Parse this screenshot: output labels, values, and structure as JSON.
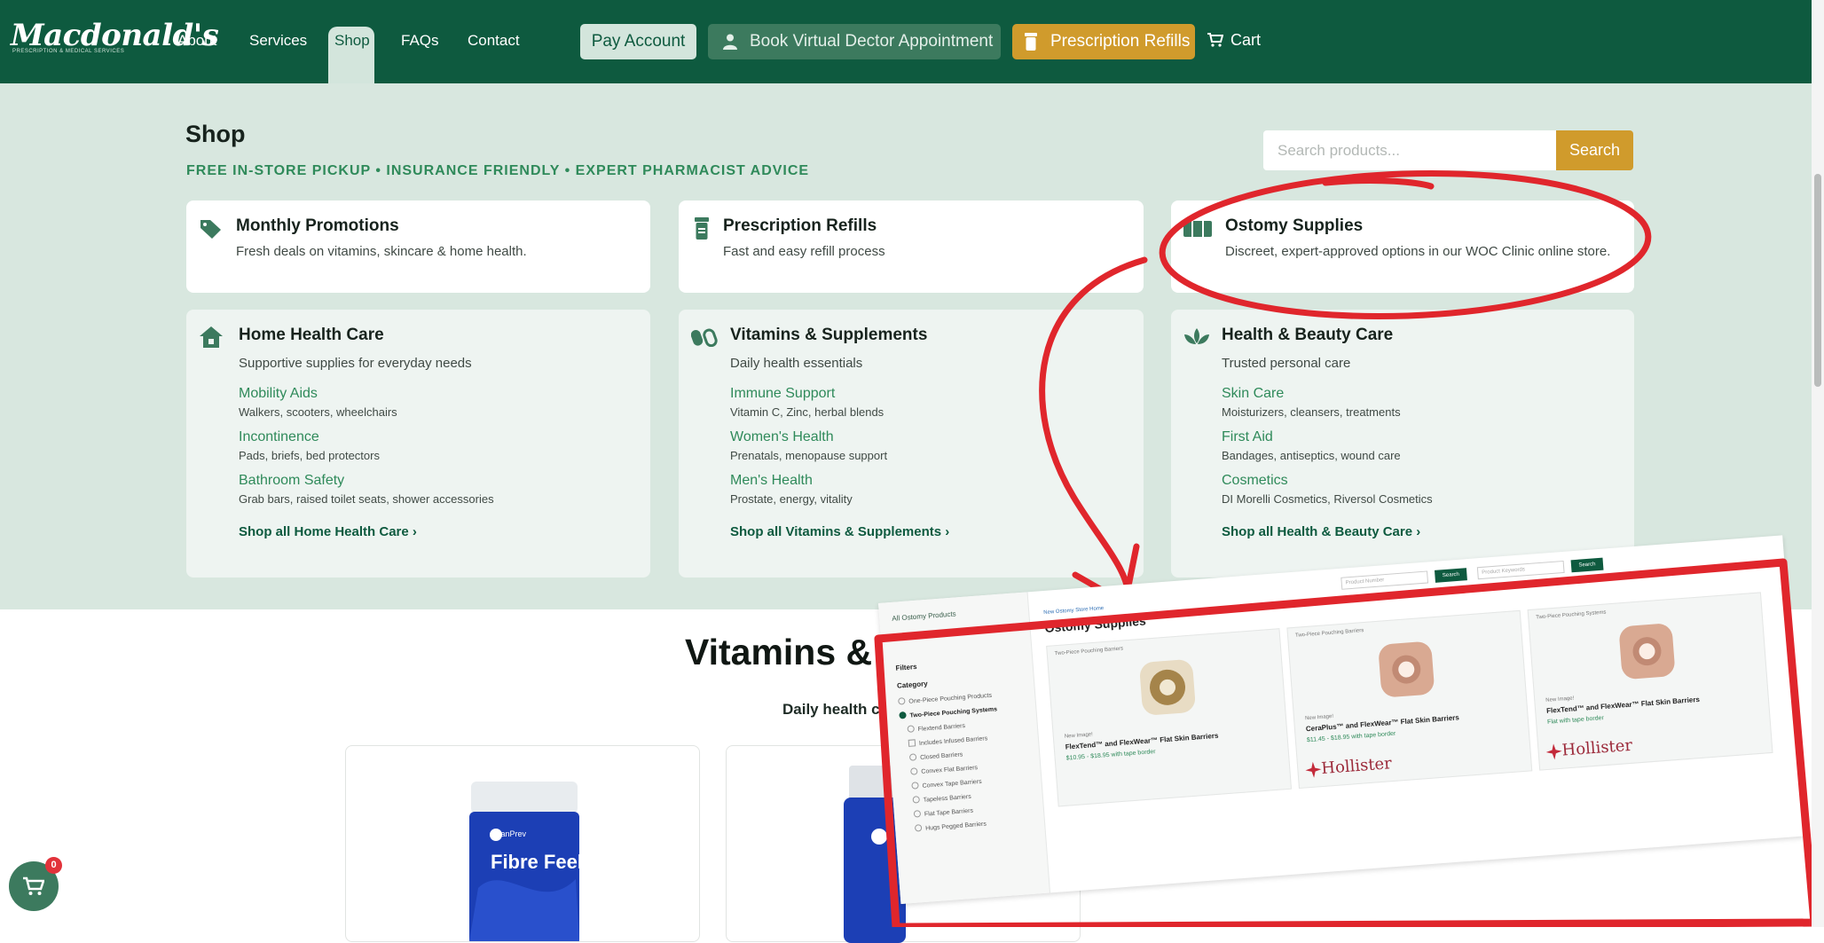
{
  "brand": {
    "name": "Macdonald's",
    "tagline": "PRESCRIPTION & MEDICAL SERVICES"
  },
  "nav": {
    "links": [
      "About",
      "Services",
      "Shop",
      "FAQs",
      "Contact"
    ],
    "active": "Shop",
    "pay_account": "Pay Account",
    "book_virtual": "Book Virtual Dector Appointment",
    "prescription_refills": "Prescription Refills",
    "cart": "Cart"
  },
  "shop": {
    "title": "Shop",
    "tagline": "FREE IN-STORE PICKUP • INSURANCE FRIENDLY • EXPERT PHARMACIST ADVICE",
    "search": {
      "placeholder": "Search products...",
      "button": "Search"
    },
    "top_cards": [
      {
        "title": "Monthly Promotions",
        "desc": "Fresh deals on vitamins, skincare & home health.",
        "icon": "tag-icon"
      },
      {
        "title": "Prescription Refills",
        "desc": "Fast and easy refill process",
        "icon": "pill-bottle-icon"
      },
      {
        "title": "Ostomy Supplies",
        "desc": "Discreet, expert-approved options in our WOC Clinic online store.",
        "icon": "supplies-icon"
      }
    ],
    "categories": [
      {
        "title": "Home Health Care",
        "desc": "Supportive supplies for everyday needs",
        "icon": "home-icon",
        "items": [
          {
            "label": "Mobility Aids",
            "desc": "Walkers, scooters, wheelchairs"
          },
          {
            "label": "Incontinence",
            "desc": "Pads, briefs, bed protectors"
          },
          {
            "label": "Bathroom Safety",
            "desc": "Grab bars, raised toilet seats, shower accessories"
          }
        ],
        "shop_all": "Shop all Home Health Care ›"
      },
      {
        "title": "Vitamins & Supplements",
        "desc": "Daily health essentials",
        "icon": "capsule-icon",
        "items": [
          {
            "label": "Immune Support",
            "desc": "Vitamin C, Zinc, herbal blends"
          },
          {
            "label": "Women's Health",
            "desc": "Prenatals, menopause support"
          },
          {
            "label": "Men's Health",
            "desc": "Prostate, energy, vitality"
          }
        ],
        "shop_all": "Shop all Vitamins & Supplements ›"
      },
      {
        "title": "Health & Beauty Care",
        "desc": "Trusted personal care",
        "icon": "lotus-icon",
        "items": [
          {
            "label": "Skin Care",
            "desc": "Moisturizers, cleansers, treatments"
          },
          {
            "label": "First Aid",
            "desc": "Bandages, antiseptics, wound care"
          },
          {
            "label": "Cosmetics",
            "desc": "DI Morelli Cosmetics, Riversol Cosmetics"
          }
        ],
        "shop_all": "Shop all Health & Beauty Care ›"
      }
    ]
  },
  "featured": {
    "title": "Vitamins & Supplements",
    "subtitle": "Daily health c",
    "products": [
      {
        "label": "Fibre Feel"
      },
      {
        "label": ""
      }
    ]
  },
  "cart_fab": {
    "count": "0"
  },
  "inset": {
    "back_link": "All Ostomy Products",
    "home_link": "Ostomy Shop Home",
    "filters": "Filters",
    "category": "Category",
    "category_items": [
      "One-Piece Pouching Products",
      "Two-Piece Pouching Systems",
      "Flextend Barriers",
      "Includes Infused Barriers",
      "Closed Barriers",
      "Convex Flat Barriers",
      "Convex Tape Barriers",
      "Tapeless Barriers",
      "Flat Tape Barriers",
      "Hugs Pegged Barriers"
    ],
    "breadcrumb": "New Ostomy Store Home",
    "title": "Ostomy Supplies",
    "product_number_placeholder": "Product Number",
    "keywords_placeholder": "Product Keywords",
    "search_btn": "Search",
    "products": [
      {
        "type": "Two-Piece Pouching Barriers",
        "flag": "New Image!",
        "name": "FlexTend™ and FlexWear™ Flat Skin Barriers",
        "price": "$10.95 - $18.95 with tape border",
        "brand": ""
      },
      {
        "type": "Two-Piece Pouching Barriers",
        "flag": "New Image!",
        "name": "CeraPlus™ and FlexWear™ Flat Skin Barriers",
        "price": "$11.45 - $18.95 with tape border",
        "brand": "Hollister"
      },
      {
        "type": "Two-Piece Pouching Systems",
        "flag": "New Image!",
        "name": "FlexTend™ and FlexWear™ Flat Skin Barriers",
        "price": "Flat with tape border",
        "brand": "Hollister"
      }
    ]
  },
  "colors": {
    "primary": "#0e5a3f",
    "accent": "#d09b2c",
    "hero_bg": "#d8e7df",
    "link": "#2f8a5a",
    "annotation": "#e0262c"
  }
}
